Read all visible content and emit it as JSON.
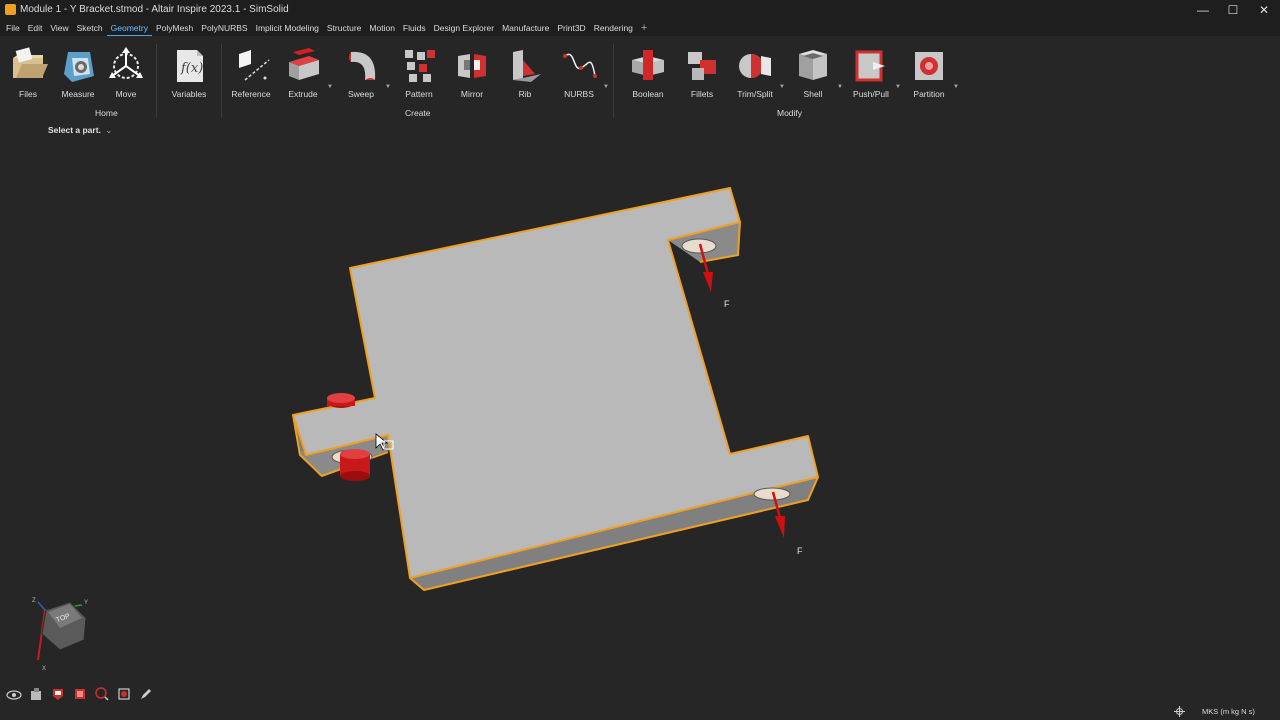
{
  "window": {
    "title": "Module 1 - Y Bracket.stmod - Altair Inspire 2023.1 - SimSolid",
    "controls": {
      "minimize": "—",
      "maximize": "☐",
      "close": "✕"
    }
  },
  "menu": {
    "items": [
      "File",
      "Edit",
      "View",
      "Sketch",
      "Geometry",
      "PolyMesh",
      "PolyNURBS",
      "Implicit Modeling",
      "Structure",
      "Motion",
      "Fluids",
      "Design Explorer",
      "Manufacture",
      "Print3D",
      "Rendering"
    ],
    "active": "Geometry",
    "add": "+"
  },
  "ribbon": {
    "groups": {
      "home": "Home",
      "create": "Create",
      "modify": "Modify"
    },
    "tools": {
      "files": "Files",
      "measure": "Measure",
      "move": "Move",
      "variables": "Variables",
      "reference": "Reference",
      "extrude": "Extrude",
      "sweep": "Sweep",
      "pattern": "Pattern",
      "mirror": "Mirror",
      "rib": "Rib",
      "nurbs": "NURBS",
      "boolean": "Boolean",
      "fillets": "Fillets",
      "trim_split": "Trim/Split",
      "shell": "Shell",
      "push_pull": "Push/Pull",
      "partition": "Partition"
    }
  },
  "guide": {
    "text": "Select a part.",
    "chevron": "⌄"
  },
  "viewport": {
    "force_labels": [
      "F",
      "F"
    ],
    "view_cube": {
      "face": "TOP",
      "axes": {
        "x": "X",
        "y": "Y",
        "z": "Z"
      }
    }
  },
  "status": {
    "units": "MKS (m kg N s)"
  },
  "colors": {
    "background": "#262626",
    "part_face": "#b9b9b9",
    "part_side": "#8c8c8c",
    "highlight": "#f0a020",
    "force_arrow": "#d01010",
    "accent": "#4aa6e8"
  }
}
